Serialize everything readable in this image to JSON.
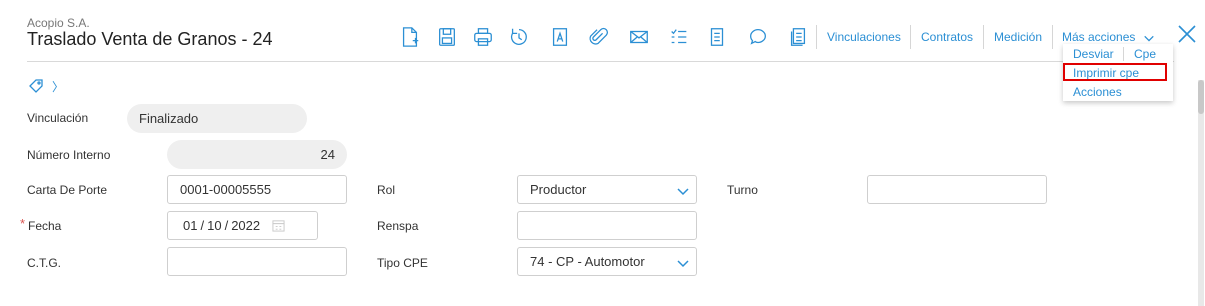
{
  "header": {
    "company": "Acopio S.A.",
    "title": "Traslado Venta de Granos - 24"
  },
  "toolbar": {
    "icons": [
      "new-document-icon",
      "save-icon",
      "print-icon",
      "refresh-icon",
      "document-a-icon",
      "paperclip-icon",
      "mail-icon",
      "checklist-icon",
      "page-icon",
      "comment-icon",
      "notes-icon"
    ],
    "links": {
      "vinculaciones": "Vinculaciones",
      "contratos": "Contratos",
      "medicion": "Medición",
      "mas_acciones": "Más acciones"
    }
  },
  "dropdown": {
    "desviar": "Desviar",
    "cpe": "Cpe",
    "imprimir_cpe": "Imprimir cpe",
    "acciones": "Acciones"
  },
  "tags": {
    "chevron": "〉"
  },
  "form": {
    "vinculacion": {
      "label": "Vinculación",
      "value": "Finalizado"
    },
    "numero_interno": {
      "label": "Número Interno",
      "value": "24"
    },
    "carta_de_porte": {
      "label": "Carta De Porte",
      "value": "0001-00005555"
    },
    "fecha": {
      "label": "Fecha",
      "required": "*",
      "day": "01",
      "month": "10",
      "year": "2022",
      "sep": "/"
    },
    "ctg": {
      "label": "C.T.G.",
      "value": ""
    },
    "rol": {
      "label": "Rol",
      "value": "Productor"
    },
    "renspa": {
      "label": "Renspa",
      "value": ""
    },
    "tipo_cpe": {
      "label": "Tipo CPE",
      "value": "74 - CP - Automotor"
    },
    "turno": {
      "label": "Turno",
      "value": ""
    }
  }
}
